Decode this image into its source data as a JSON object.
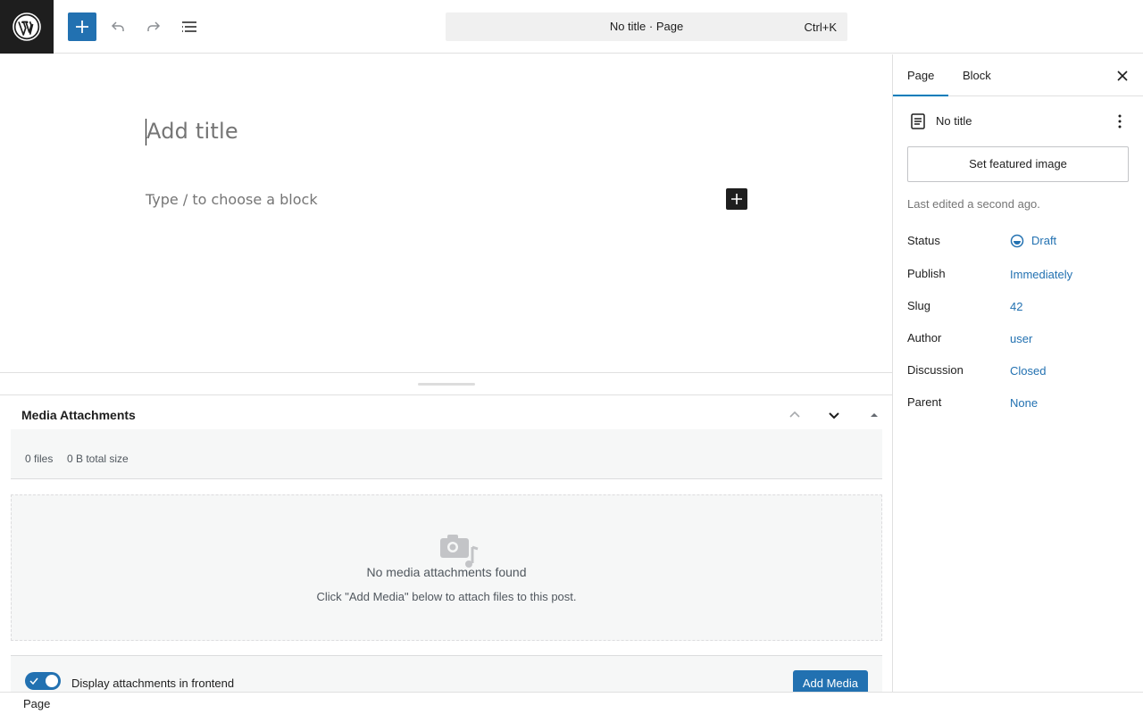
{
  "toolbar": {
    "command_title": "No title · Page",
    "command_shortcut": "Ctrl+K"
  },
  "editor": {
    "title_placeholder": "Add title",
    "block_placeholder": "Type / to choose a block"
  },
  "metabox": {
    "title": "Media Attachments",
    "files_count": "0 files",
    "total_size": "0 B total size",
    "empty_title": "No media attachments found",
    "empty_description": "Click \"Add Media\" below to attach files to this post.",
    "toggle_label": "Display attachments in frontend",
    "toggle_on": true,
    "add_media_label": "Add Media"
  },
  "sidebar": {
    "tabs": [
      {
        "label": "Page",
        "active": true
      },
      {
        "label": "Block",
        "active": false
      }
    ],
    "doc_title": "No title",
    "featured_image_label": "Set featured image",
    "last_edited": "Last edited a second ago.",
    "properties": [
      {
        "label": "Status",
        "value": "Draft"
      },
      {
        "label": "Publish",
        "value": "Immediately"
      },
      {
        "label": "Slug",
        "value": "42"
      },
      {
        "label": "Author",
        "value": "user"
      },
      {
        "label": "Discussion",
        "value": "Closed"
      },
      {
        "label": "Parent",
        "value": "None"
      }
    ]
  },
  "statusbar": {
    "breadcrumb": "Page"
  },
  "colors": {
    "accent": "#2271b1",
    "dark": "#1e1e1e"
  }
}
